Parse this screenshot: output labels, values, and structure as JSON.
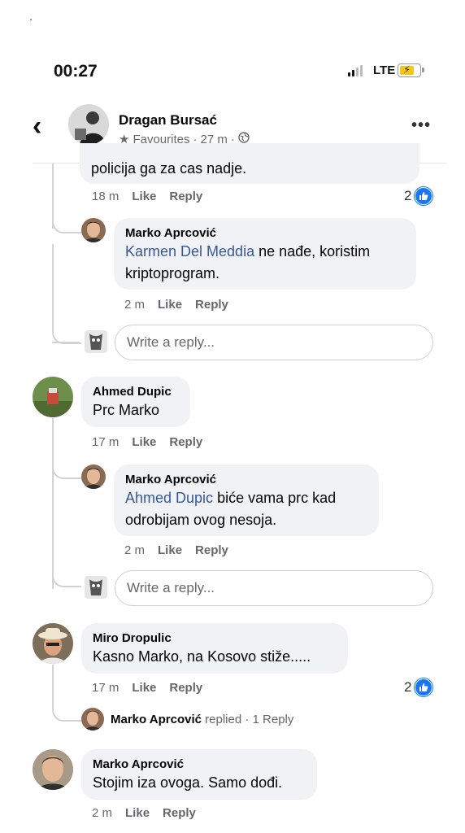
{
  "status_bar": {
    "time": "00:27",
    "network": "LTE"
  },
  "header": {
    "name": "Dragan Bursać",
    "favourites": "Favourites",
    "age": "27 m"
  },
  "comments": {
    "c1_text": "policija ga za cas nadje.",
    "c1_time": "18 m",
    "c1_reacts": "2",
    "c2_name": "Marko Aprcović",
    "c2_mention": "Karmen Del Meddia",
    "c2_text1": " ne nađe, koristim",
    "c2_text2": "kriptoprogram.",
    "c2_time": "2 m",
    "c3_name": "Ahmed Dupic",
    "c3_text": "Prc Marko",
    "c3_time": "17 m",
    "c4_name": "Marko Aprcović",
    "c4_mention": "Ahmed Dupic",
    "c4_text1": " biće vama prc kad",
    "c4_text2": "odrobijam ovog nesoja.",
    "c4_time": "2 m",
    "c5_name": "Miro Dropulic",
    "c5_text": "Kasno Marko, na Kosovo stiže.....",
    "c5_time": "17 m",
    "c5_reacts": "2",
    "c5_replied_name": "Marko Aprcović",
    "c5_replied_text": "replied",
    "c5_replied_count": "1 Reply",
    "c6_name": "Marko Aprcović",
    "c6_text": "Stojim iza ovoga. Samo dođi.",
    "c6_time": "2 m"
  },
  "actions": {
    "like": "Like",
    "reply": "Reply"
  },
  "reply_input": {
    "placeholder": "Write a reply..."
  },
  "colors": {
    "link": "#385898",
    "bubble": "#f0f2f5",
    "like_blue": "#1877f2"
  }
}
